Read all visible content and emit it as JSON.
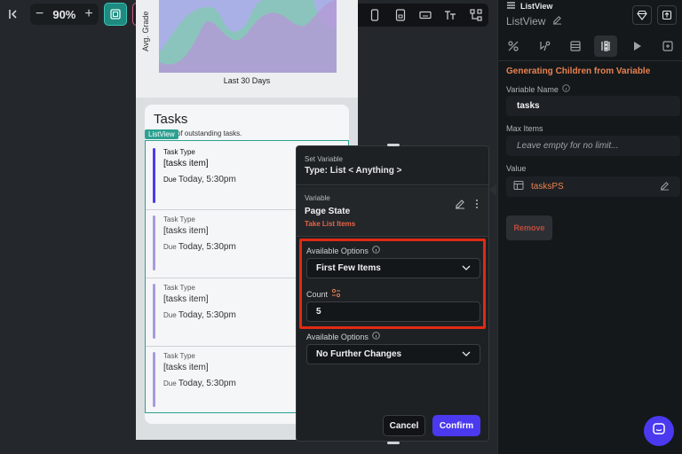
{
  "toolbar": {
    "zoom": "90%",
    "zoom_minus": "−",
    "zoom_plus": "+"
  },
  "chart": {
    "ylabel": "Avg. Grade",
    "xlabel": "Last 30 Days"
  },
  "tasks_card": {
    "title": "Tasks",
    "subtitle": "mary of outstanding tasks.",
    "listview_tag": "ListView",
    "items": [
      {
        "type": "Task Type",
        "name": "[tasks item]",
        "due_label": "Due",
        "due": "Today, 5:30pm"
      },
      {
        "type": "Task Type",
        "name": "[tasks item]",
        "due_label": "Due",
        "due": "Today, 5:30pm"
      },
      {
        "type": "Task Type",
        "name": "[tasks item]",
        "due_label": "Due",
        "due": "Today, 5:30pm"
      },
      {
        "type": "Task Type",
        "name": "[tasks item]",
        "due_label": "Due",
        "due": "Today, 5:30pm"
      }
    ]
  },
  "modal": {
    "header_label": "Set Variable",
    "header_type": "Type: List < Anything >",
    "variable_label": "Variable",
    "variable_value": "Page State",
    "variable_action": "Take List Items",
    "available_options_label": "Available Options",
    "available_options_value": "First Few Items",
    "count_label": "Count",
    "count_value": "5",
    "available_options_label_2": "Available Options",
    "available_options_value_2": "No Further Changes",
    "cancel": "Cancel",
    "confirm": "Confirm"
  },
  "right_panel": {
    "widget_type": "ListView",
    "widget_name": "ListView",
    "section_title": "Generating Children from Variable",
    "variable_name_label": "Variable Name",
    "variable_name_value": "tasks",
    "max_items_label": "Max Items",
    "max_items_placeholder": "Leave empty for no limit...",
    "value_label": "Value",
    "value_value": "tasksPS",
    "remove": "Remove"
  },
  "colors": {
    "accent": "#4b39ef",
    "teal": "#2ca191",
    "orange": "#e9824f",
    "highlight": "#e02a14"
  }
}
